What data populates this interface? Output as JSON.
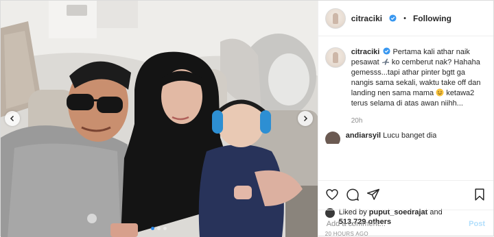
{
  "header": {
    "username": "citraciki",
    "separator": "•",
    "follow_status": "Following"
  },
  "caption": {
    "username": "citraciki",
    "text_part1": "Pertama kali athar naik pesawat",
    "text_part2": "ko cemberut nak? Hahaha gemesss...tapi athar pinter bgtt ga nangis sama sekali, waktu take off dan landing nen sama mama",
    "text_part3": "ketawa2 terus selama di atas awan niihh...",
    "time": "20h",
    "emoji_1": "airplane-emoji",
    "emoji_2": "smiling-face-emoji"
  },
  "comment": {
    "username": "andiarsyil",
    "text": "Lucu banget dia"
  },
  "likes": {
    "prefix": "Liked by",
    "user": "puput_soedrajat",
    "and": "and",
    "count": "513,729 others"
  },
  "posted_ago": "20 HOURS AGO",
  "add_comment": {
    "placeholder": "Add a comment...",
    "post_label": "Post"
  },
  "carousel": {
    "total": 3,
    "active_index": 0
  },
  "colors": {
    "verified": "#3897f0",
    "active_dot": "#2f88e5",
    "post_button": "#b2dffc"
  }
}
